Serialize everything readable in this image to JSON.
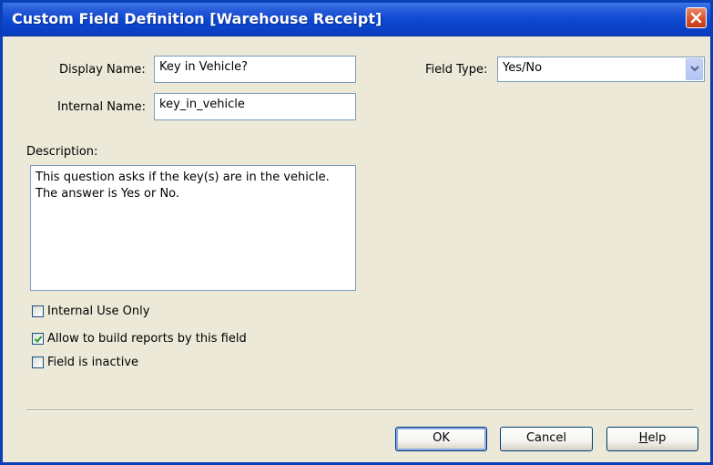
{
  "window": {
    "title": "Custom Field Definition [Warehouse Receipt]"
  },
  "form": {
    "display_name_label": "Display Name:",
    "display_name_value": "Key in Vehicle?",
    "internal_name_label": "Internal Name:",
    "internal_name_value": "key_in_vehicle",
    "field_type_label": "Field Type:",
    "field_type_value": "Yes/No",
    "description_label": "Description:",
    "description_lines": [
      "This question asks if the key(s) are in the vehicle.",
      "The answer is Yes or No."
    ]
  },
  "options": [
    {
      "label": "Internal Use Only",
      "checked": false
    },
    {
      "label": "Allow to build reports by this field",
      "checked": true
    },
    {
      "label": "Field is inactive",
      "checked": false
    }
  ],
  "buttons": {
    "ok": "OK",
    "cancel": "Cancel",
    "help_mnemonic": "H",
    "help_rest": "elp"
  },
  "icons": {
    "close": "close-icon",
    "dropdown": "chevron-down-icon",
    "check": "checkmark-icon"
  },
  "colors": {
    "titlebar": "#0a3cbf",
    "close_button": "#d9562f",
    "check": "#21a121"
  }
}
